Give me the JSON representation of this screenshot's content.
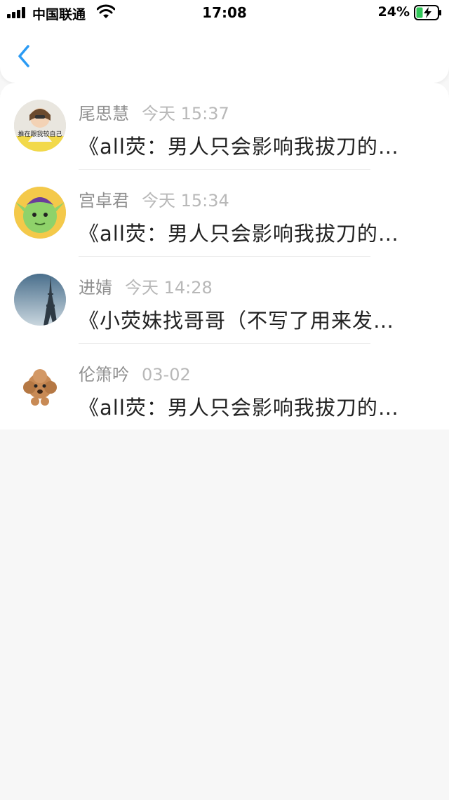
{
  "status_bar": {
    "carrier": "中国联通",
    "time": "17:08",
    "battery_percent": "24%",
    "icons": [
      "signal-icon",
      "wifi-icon",
      "battery-charging-icon"
    ]
  },
  "header": {
    "back_icon": "chevron-left-icon",
    "accent_color": "#2b9bf4"
  },
  "messages": [
    {
      "name": "尾思慧",
      "time": "今天 15:37",
      "text": "《all荧：男人只会影响我拔刀的…",
      "avatar": "girl-photo-avatar"
    },
    {
      "name": "宫卓君",
      "time": "今天 15:34",
      "text": "《all荧：男人只会影响我拔刀的…",
      "avatar": "green-goblin-avatar"
    },
    {
      "name": "进婧",
      "time": "今天 14:28",
      "text": "《小荧妹找哥哥（不写了用来发…",
      "avatar": "eiffel-tower-avatar"
    },
    {
      "name": "伦箫吟",
      "time": "03-02",
      "text": "《all荧：男人只会影响我拔刀的…",
      "avatar": "poodle-avatar"
    }
  ]
}
